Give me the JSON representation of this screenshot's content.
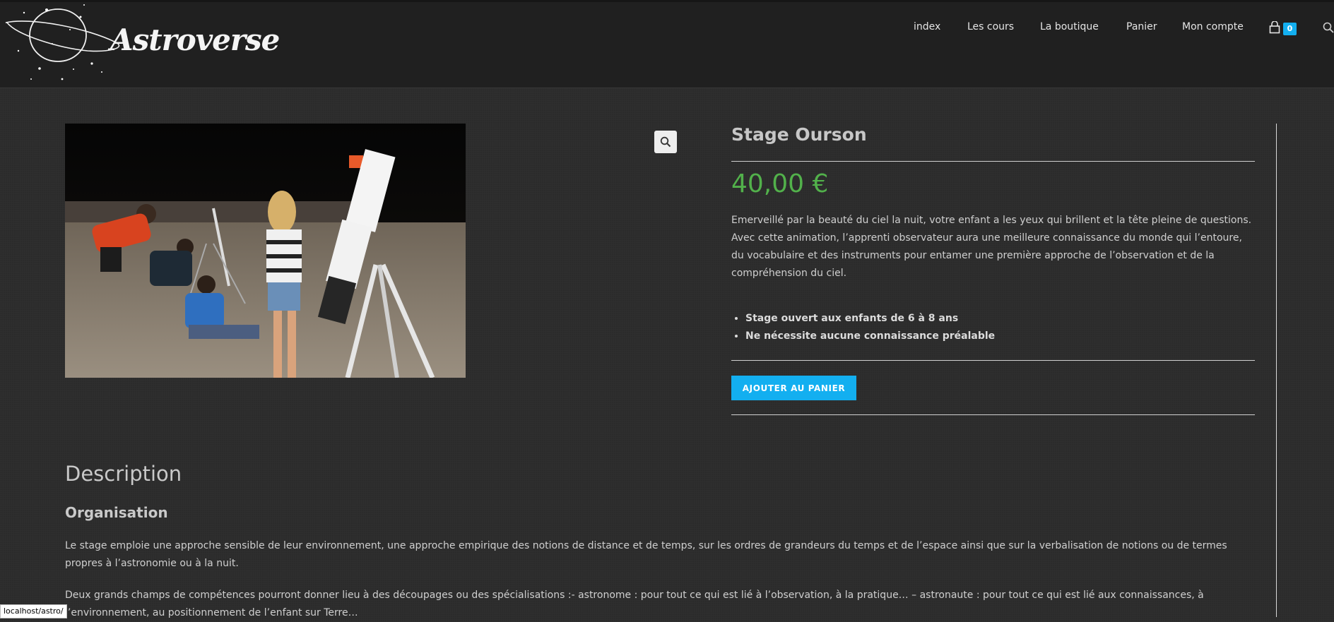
{
  "site": {
    "name": "Astroverse"
  },
  "nav": {
    "items": [
      {
        "label": "index"
      },
      {
        "label": "Les cours"
      },
      {
        "label": "La boutique"
      },
      {
        "label": "Panier"
      },
      {
        "label": "Mon compte"
      }
    ],
    "cart_count": "0"
  },
  "product": {
    "title": "Stage Ourson",
    "price": "40,00 €",
    "short_description": "Emerveillé par la beauté du ciel la nuit, votre enfant a les yeux qui brillent et la tête pleine de questions. Avec cette animation, l’apprenti observateur aura une meilleure connaissance du monde qui l’entoure, du vocabulaire et des instruments pour entamer une première approche de l’observation et de la compréhension du ciel.",
    "features": [
      "Stage ouvert aux enfants de 6 à 8 ans",
      "Ne nécessite aucune connaissance préalable"
    ],
    "add_to_cart_label": "AJOUTER AU PANIER"
  },
  "description": {
    "heading": "Description",
    "subheading": "Organisation",
    "paragraphs": [
      "Le stage emploie une approche sensible de leur environnement, une approche empirique des notions de distance et de temps, sur les ordres de grandeurs du temps et de l’espace ainsi que sur la verbalisation de notions ou de termes propres à l’astronomie ou à la nuit.",
      "Deux grands champs de compétences pourront donner lieu à des découpages ou des spécialisations :- astronome : pour tout ce qui est lié à l’observation, à la pratique… – astronaute : pour tout ce qui est lié aux connaissances, à l’environnement, au positionnement de l’enfant sur Terre…"
    ]
  },
  "status_bar": {
    "url": "localhost/astro/"
  },
  "colors": {
    "accent": "#13aff0",
    "price": "#52b14b",
    "header_bg": "#202020",
    "page_bg": "#2b2b2b"
  },
  "icons": [
    "planet-logo-icon",
    "cart-icon",
    "search-icon",
    "zoom-icon"
  ]
}
